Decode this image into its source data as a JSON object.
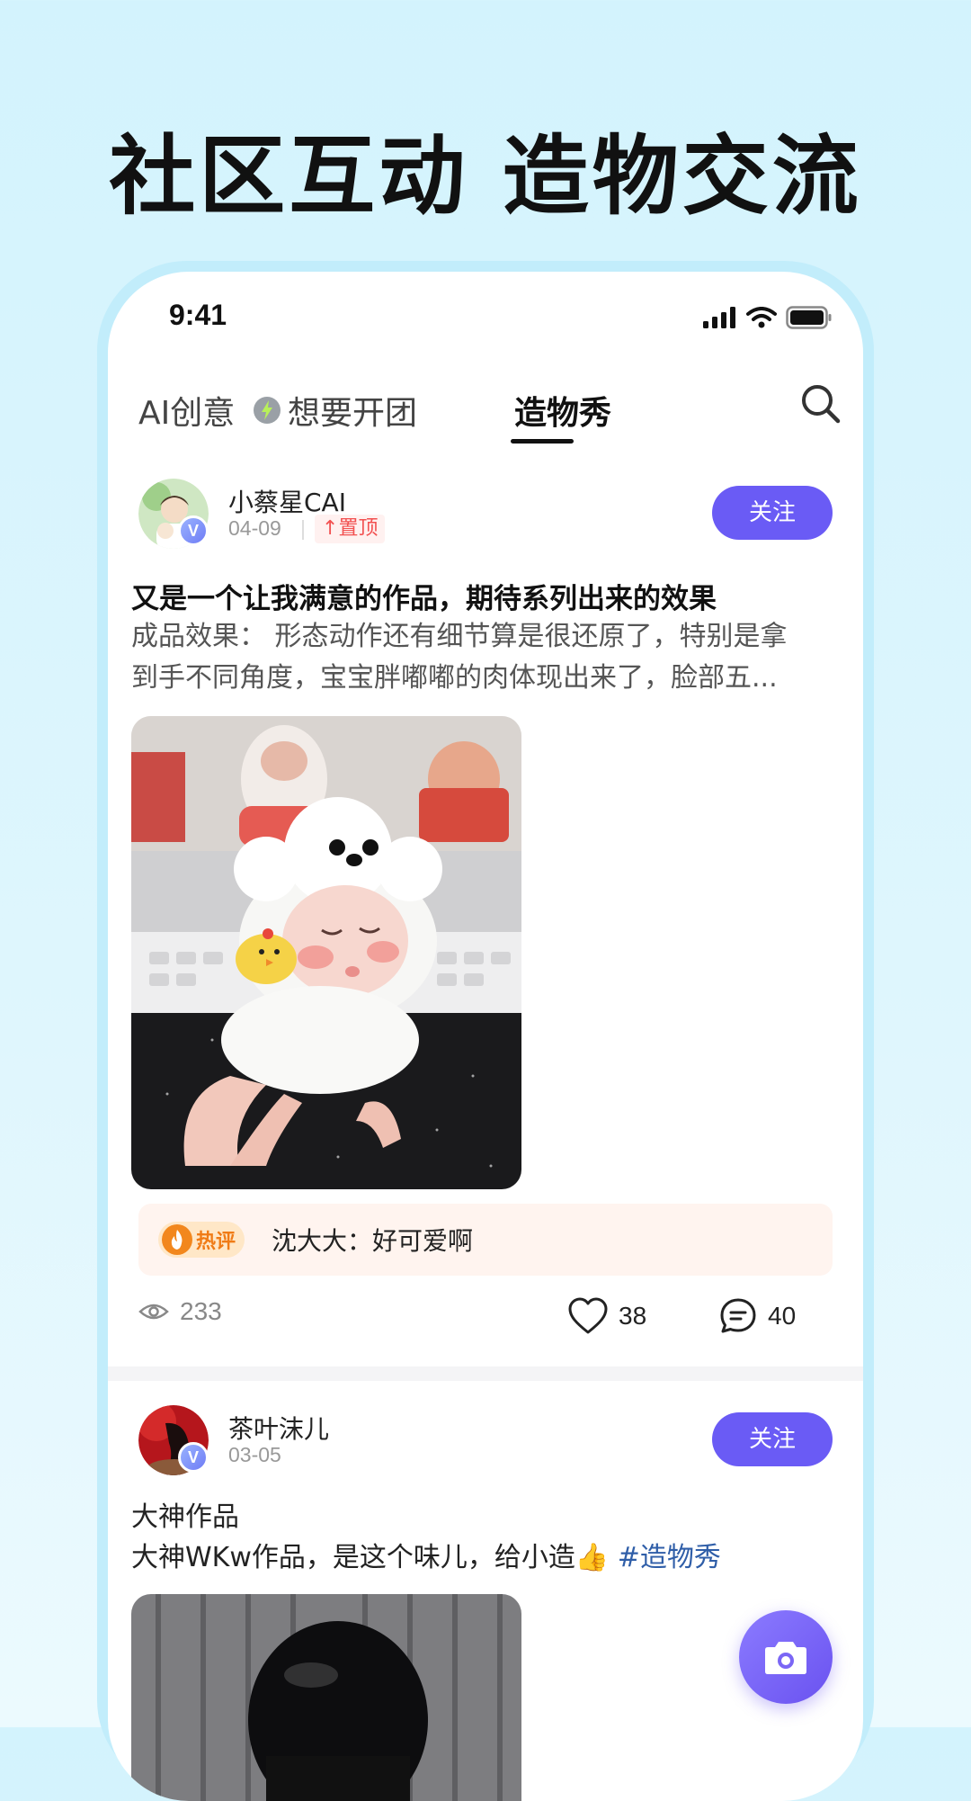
{
  "headline": "社区互动 造物交流",
  "status_bar": {
    "time": "9:41"
  },
  "tabs": [
    {
      "label": "AI创意",
      "active": false
    },
    {
      "label": "想要开团",
      "active": false
    },
    {
      "label": "造物秀",
      "active": true
    }
  ],
  "posts": [
    {
      "user": "小蔡星CAI",
      "date": "04-09",
      "pinned_label": "置顶",
      "follow_label": "关注",
      "title": "又是一个让我满意的作品，期待系列出来的效果",
      "body_line1": "成品效果： 形态动作还有细节算是很还原了，特别是拿",
      "body_line2": "到手不同角度，宝宝胖嘟嘟的肉体现出来了，脸部五...",
      "hot_comment_label": "热评",
      "hot_comment": "沈大大：好可爱啊",
      "views": "233",
      "likes": "38",
      "comments": "40"
    },
    {
      "user": "茶叶沫儿",
      "date": "03-05",
      "follow_label": "关注",
      "title": "大神作品",
      "body": "大神WKw作品，是这个味儿，给小造👍",
      "hashtag": "#造物秀"
    }
  ],
  "colors": {
    "accent": "#6a5bf5",
    "background": "#d3f3fd",
    "frame": "#c2edfb",
    "pin": "#f25050",
    "hot": "#f07b16",
    "hashtag": "#2f5ea8"
  },
  "icons": [
    "signal-icon",
    "wifi-icon",
    "battery-icon",
    "lightning-icon",
    "search-icon",
    "verified-icon",
    "pin-arrow-icon",
    "flame-icon",
    "eye-icon",
    "heart-icon",
    "comment-icon",
    "camera-icon"
  ]
}
